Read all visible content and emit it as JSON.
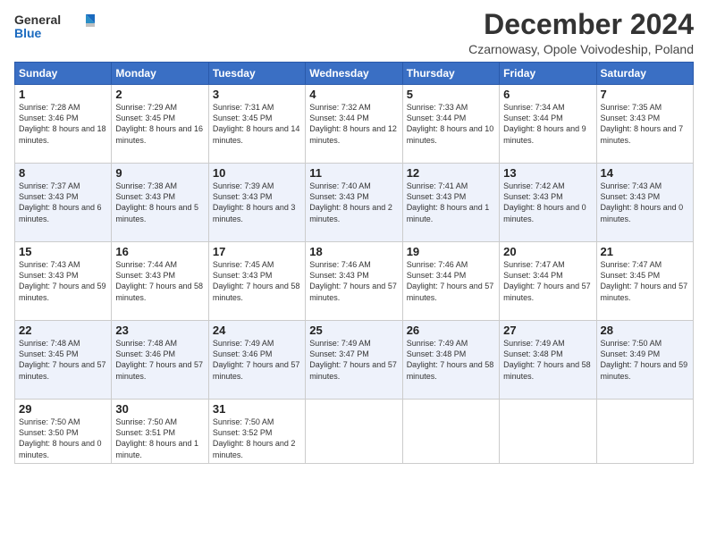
{
  "logo": {
    "line1": "General",
    "line2": "Blue"
  },
  "title": "December 2024",
  "subtitle": "Czarnowasy, Opole Voivodeship, Poland",
  "days_of_week": [
    "Sunday",
    "Monday",
    "Tuesday",
    "Wednesday",
    "Thursday",
    "Friday",
    "Saturday"
  ],
  "weeks": [
    [
      {
        "day": "1",
        "sunrise": "7:28 AM",
        "sunset": "3:46 PM",
        "daylight": "8 hours and 18 minutes."
      },
      {
        "day": "2",
        "sunrise": "7:29 AM",
        "sunset": "3:45 PM",
        "daylight": "8 hours and 16 minutes."
      },
      {
        "day": "3",
        "sunrise": "7:31 AM",
        "sunset": "3:45 PM",
        "daylight": "8 hours and 14 minutes."
      },
      {
        "day": "4",
        "sunrise": "7:32 AM",
        "sunset": "3:44 PM",
        "daylight": "8 hours and 12 minutes."
      },
      {
        "day": "5",
        "sunrise": "7:33 AM",
        "sunset": "3:44 PM",
        "daylight": "8 hours and 10 minutes."
      },
      {
        "day": "6",
        "sunrise": "7:34 AM",
        "sunset": "3:44 PM",
        "daylight": "8 hours and 9 minutes."
      },
      {
        "day": "7",
        "sunrise": "7:35 AM",
        "sunset": "3:43 PM",
        "daylight": "8 hours and 7 minutes."
      }
    ],
    [
      {
        "day": "8",
        "sunrise": "7:37 AM",
        "sunset": "3:43 PM",
        "daylight": "8 hours and 6 minutes."
      },
      {
        "day": "9",
        "sunrise": "7:38 AM",
        "sunset": "3:43 PM",
        "daylight": "8 hours and 5 minutes."
      },
      {
        "day": "10",
        "sunrise": "7:39 AM",
        "sunset": "3:43 PM",
        "daylight": "8 hours and 3 minutes."
      },
      {
        "day": "11",
        "sunrise": "7:40 AM",
        "sunset": "3:43 PM",
        "daylight": "8 hours and 2 minutes."
      },
      {
        "day": "12",
        "sunrise": "7:41 AM",
        "sunset": "3:43 PM",
        "daylight": "8 hours and 1 minute."
      },
      {
        "day": "13",
        "sunrise": "7:42 AM",
        "sunset": "3:43 PM",
        "daylight": "8 hours and 0 minutes."
      },
      {
        "day": "14",
        "sunrise": "7:43 AM",
        "sunset": "3:43 PM",
        "daylight": "8 hours and 0 minutes."
      }
    ],
    [
      {
        "day": "15",
        "sunrise": "7:43 AM",
        "sunset": "3:43 PM",
        "daylight": "7 hours and 59 minutes."
      },
      {
        "day": "16",
        "sunrise": "7:44 AM",
        "sunset": "3:43 PM",
        "daylight": "7 hours and 58 minutes."
      },
      {
        "day": "17",
        "sunrise": "7:45 AM",
        "sunset": "3:43 PM",
        "daylight": "7 hours and 58 minutes."
      },
      {
        "day": "18",
        "sunrise": "7:46 AM",
        "sunset": "3:43 PM",
        "daylight": "7 hours and 57 minutes."
      },
      {
        "day": "19",
        "sunrise": "7:46 AM",
        "sunset": "3:44 PM",
        "daylight": "7 hours and 57 minutes."
      },
      {
        "day": "20",
        "sunrise": "7:47 AM",
        "sunset": "3:44 PM",
        "daylight": "7 hours and 57 minutes."
      },
      {
        "day": "21",
        "sunrise": "7:47 AM",
        "sunset": "3:45 PM",
        "daylight": "7 hours and 57 minutes."
      }
    ],
    [
      {
        "day": "22",
        "sunrise": "7:48 AM",
        "sunset": "3:45 PM",
        "daylight": "7 hours and 57 minutes."
      },
      {
        "day": "23",
        "sunrise": "7:48 AM",
        "sunset": "3:46 PM",
        "daylight": "7 hours and 57 minutes."
      },
      {
        "day": "24",
        "sunrise": "7:49 AM",
        "sunset": "3:46 PM",
        "daylight": "7 hours and 57 minutes."
      },
      {
        "day": "25",
        "sunrise": "7:49 AM",
        "sunset": "3:47 PM",
        "daylight": "7 hours and 57 minutes."
      },
      {
        "day": "26",
        "sunrise": "7:49 AM",
        "sunset": "3:48 PM",
        "daylight": "7 hours and 58 minutes."
      },
      {
        "day": "27",
        "sunrise": "7:49 AM",
        "sunset": "3:48 PM",
        "daylight": "7 hours and 58 minutes."
      },
      {
        "day": "28",
        "sunrise": "7:50 AM",
        "sunset": "3:49 PM",
        "daylight": "7 hours and 59 minutes."
      }
    ],
    [
      {
        "day": "29",
        "sunrise": "7:50 AM",
        "sunset": "3:50 PM",
        "daylight": "8 hours and 0 minutes."
      },
      {
        "day": "30",
        "sunrise": "7:50 AM",
        "sunset": "3:51 PM",
        "daylight": "8 hours and 1 minute."
      },
      {
        "day": "31",
        "sunrise": "7:50 AM",
        "sunset": "3:52 PM",
        "daylight": "8 hours and 2 minutes."
      },
      null,
      null,
      null,
      null
    ]
  ]
}
